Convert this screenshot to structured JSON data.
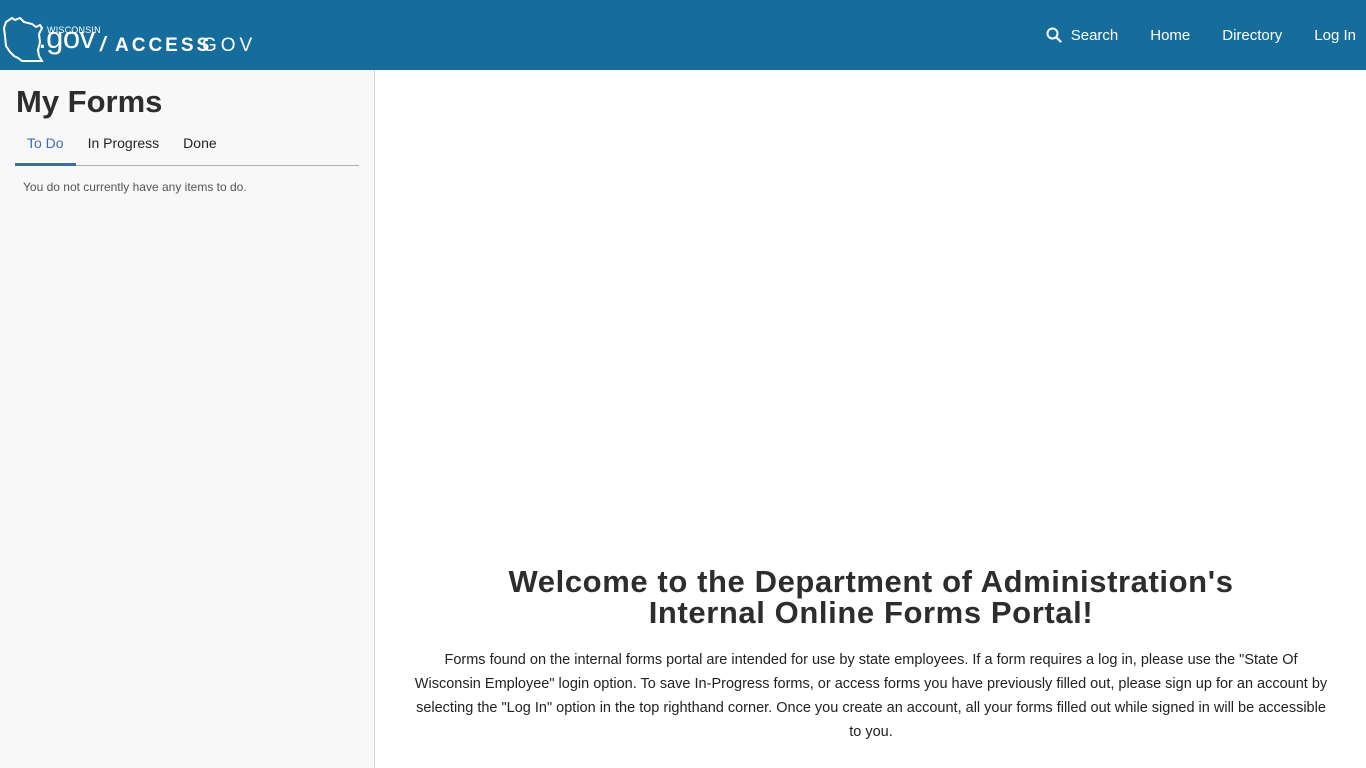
{
  "header": {
    "logo": {
      "state_label": "WISCONSIN",
      "gov_text": ".gov",
      "separator": "/",
      "access_text": "ACCESS",
      "gov_suffix": "GOV"
    },
    "nav": {
      "search_label": "Search",
      "home_label": "Home",
      "directory_label": "Directory",
      "login_label": "Log In"
    },
    "colors": {
      "header_bg": "#166d9c",
      "accent": "#3f6aa8"
    }
  },
  "sidebar": {
    "title": "My Forms",
    "tabs": [
      {
        "label": "To Do",
        "active": true
      },
      {
        "label": "In Progress",
        "active": false
      },
      {
        "label": "Done",
        "active": false
      }
    ],
    "empty_message": "You do not currently have any items to do."
  },
  "main": {
    "welcome_line1": "Welcome to the Department of Administration's",
    "welcome_line2": "Internal Online Forms Portal!",
    "description": "Forms found on the internal forms portal are intended for use by state employees. If a form requires a log in, please use the \"State Of Wisconsin Employee\" login option. To save In-Progress forms, or access forms you have previously filled out, please sign up for an account by selecting the \"Log In\" option in the top righthand corner. Once you create an account, all your forms filled out while signed in will be accessible to you."
  }
}
